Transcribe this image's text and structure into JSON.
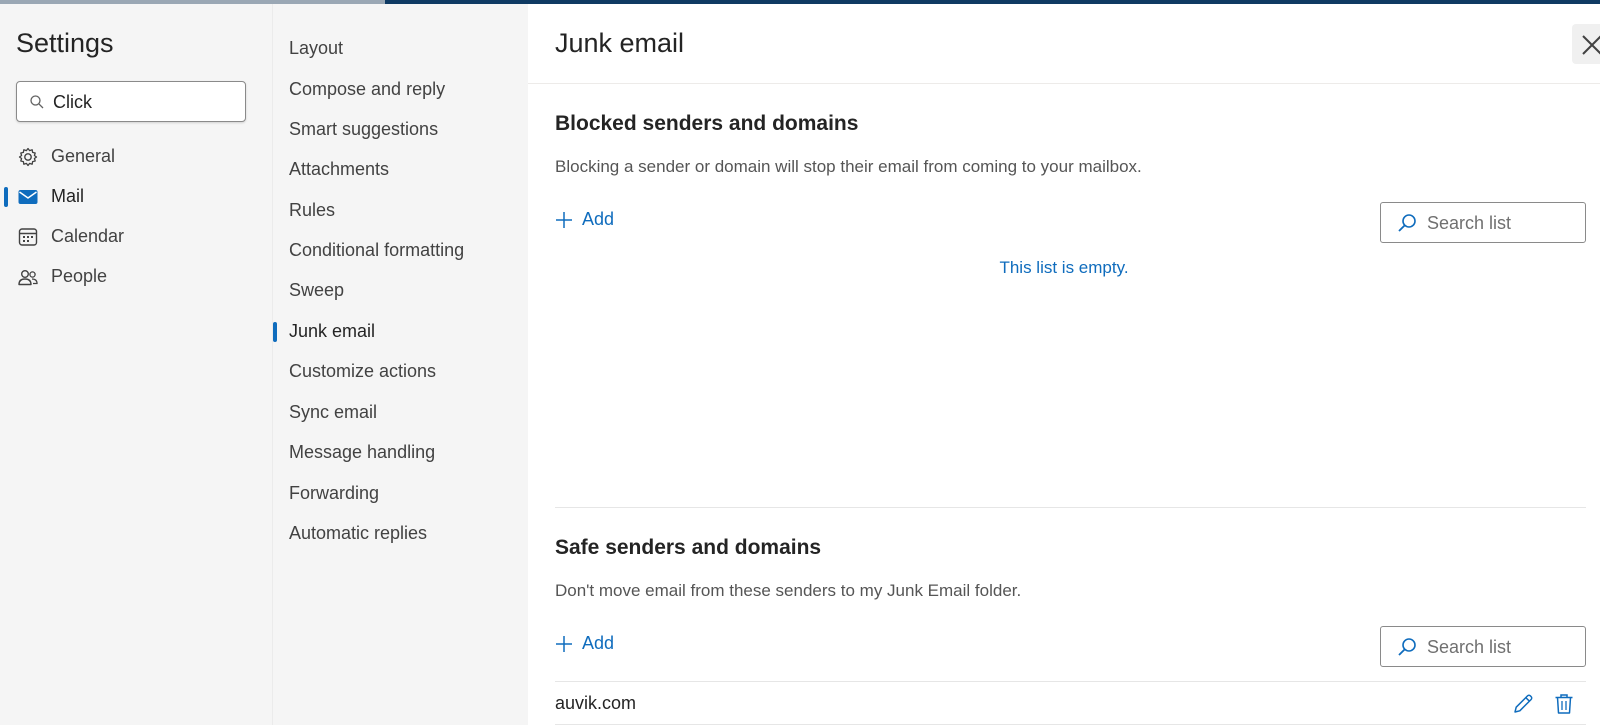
{
  "colors": {
    "accent": "#0f6cbd",
    "topbar": "#0f3a63",
    "panel_bg": "#f5f5f5",
    "text": "#242424"
  },
  "sidebar": {
    "title": "Settings",
    "search": {
      "value": "Click",
      "icon": "search-icon"
    },
    "items": [
      {
        "label": "General",
        "icon": "gear-icon",
        "active": false
      },
      {
        "label": "Mail",
        "icon": "mail-icon",
        "active": true
      },
      {
        "label": "Calendar",
        "icon": "calendar-icon",
        "active": false
      },
      {
        "label": "People",
        "icon": "people-icon",
        "active": false
      }
    ]
  },
  "subnav": {
    "items": [
      {
        "label": "Layout",
        "active": false
      },
      {
        "label": "Compose and reply",
        "active": false
      },
      {
        "label": "Smart suggestions",
        "active": false
      },
      {
        "label": "Attachments",
        "active": false
      },
      {
        "label": "Rules",
        "active": false
      },
      {
        "label": "Conditional formatting",
        "active": false
      },
      {
        "label": "Sweep",
        "active": false
      },
      {
        "label": "Junk email",
        "active": true
      },
      {
        "label": "Customize actions",
        "active": false
      },
      {
        "label": "Sync email",
        "active": false
      },
      {
        "label": "Message handling",
        "active": false
      },
      {
        "label": "Forwarding",
        "active": false
      },
      {
        "label": "Automatic replies",
        "active": false
      }
    ]
  },
  "main": {
    "title": "Junk email",
    "close_icon": "close-icon",
    "blocked": {
      "title": "Blocked senders and domains",
      "description": "Blocking a sender or domain will stop their email from coming to your mailbox.",
      "add_label": "Add",
      "search_placeholder": "Search list",
      "empty_message": "This list is empty."
    },
    "safe": {
      "title": "Safe senders and domains",
      "description": "Don't move email from these senders to my Junk Email folder.",
      "add_label": "Add",
      "search_placeholder": "Search list",
      "entries": [
        {
          "domain": "auvik.com",
          "actions": [
            "edit-icon",
            "delete-icon"
          ]
        }
      ]
    }
  }
}
